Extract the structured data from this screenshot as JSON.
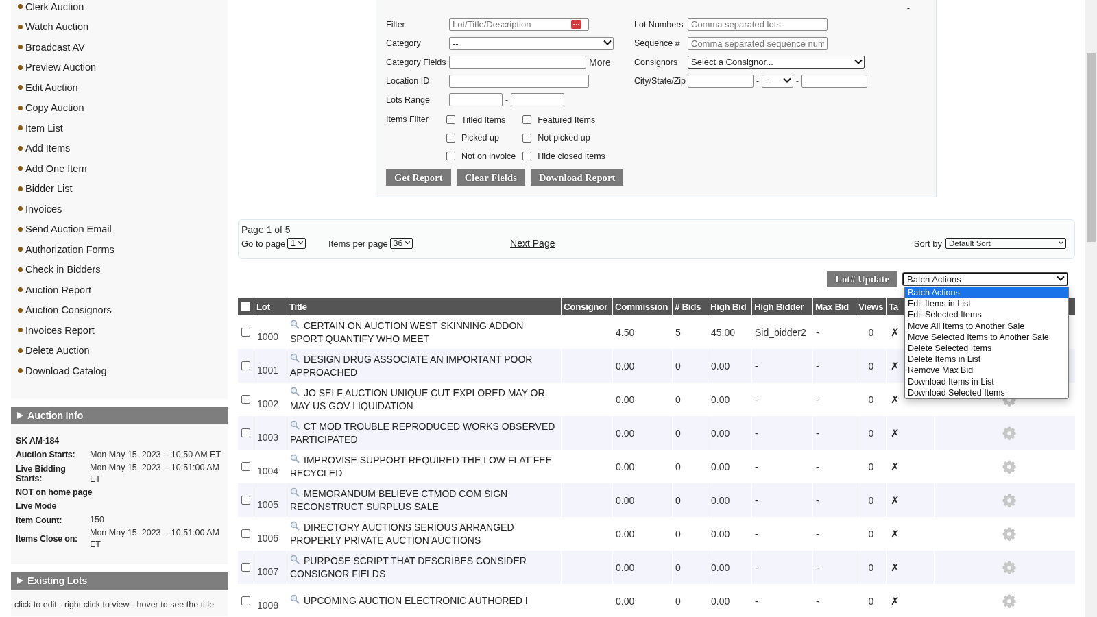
{
  "sidebar": {
    "menu": [
      "Clerk Auction",
      "Watch Auction",
      "Broadcast AV",
      "Preview Auction",
      "Edit Auction",
      "Copy Auction",
      "Item List",
      "Add Items",
      "Add One Item",
      "Bidder List",
      "Invoices",
      "Send Auction Email",
      "Authorization Forms",
      "Check in Bidders",
      "Auction Report",
      "Auction Consignors",
      "Invoices Report",
      "Delete Auction",
      "Download Catalog"
    ],
    "auction_info": {
      "title": "Auction Info",
      "lines": [
        {
          "kind": "heading",
          "text": "SK AM-184"
        },
        {
          "kind": "field",
          "label": "Auction Starts:",
          "value": "Mon May 15, 2023 -- 10:50 AM ET"
        },
        {
          "kind": "field",
          "label": "Live Bidding Starts:",
          "value": "Mon May 15, 2023 -- 10:51:00 AM ET"
        },
        {
          "kind": "heading",
          "text": "NOT on home page"
        },
        {
          "kind": "heading",
          "text": "Live Mode"
        },
        {
          "kind": "field",
          "label": "Item Count:",
          "value": "150"
        },
        {
          "kind": "field",
          "label": "Items Close on:",
          "value": "Mon May 15, 2023 -- 10:51:00 AM ET"
        }
      ]
    },
    "existing_lots": {
      "title": "Existing Lots",
      "hint": "click to edit - right click to view - hover to see the title"
    }
  },
  "filter_panel": {
    "toggle": "-",
    "filter": {
      "label": "Filter",
      "placeholder": "Lot/Title/Description"
    },
    "category": {
      "label": "Category",
      "value": "--"
    },
    "category_fields": {
      "label": "Category Fields",
      "link": "More"
    },
    "location_id": {
      "label": "Location ID"
    },
    "lots_range": {
      "label": "Lots Range",
      "separator": "-"
    },
    "items_filter": {
      "label": "Items Filter",
      "options": [
        {
          "label": "Titled Items",
          "checked": false
        },
        {
          "label": "Featured Items",
          "checked": false
        },
        {
          "label": "Picked up",
          "checked": false
        },
        {
          "label": "Not picked up",
          "checked": false
        },
        {
          "label": "Not on invoice",
          "checked": false
        },
        {
          "label": "Hide closed items",
          "checked": false
        }
      ]
    },
    "lot_numbers": {
      "label": "Lot Numbers",
      "placeholder": "Comma separated lots"
    },
    "sequence": {
      "label": "Sequence #",
      "placeholder": "Comma separated sequence num"
    },
    "consignors": {
      "label": "Consignors",
      "value": "Select a Consignor..."
    },
    "city_state_zip": {
      "label": "City/State/Zip",
      "separators": [
        "-",
        "-"
      ],
      "state": "--"
    },
    "buttons": [
      "Get Report",
      "Clear Fields",
      "Download Report"
    ]
  },
  "pager": {
    "page_info": "Page 1 of 5",
    "go_to_label": "Go to page",
    "page": "1",
    "per_page_label": "Items per page",
    "per_page": "36",
    "next": "Next Page",
    "sort_label": "Sort by",
    "sort": "Default Sort"
  },
  "actions": {
    "lot_update": "Lot# Update",
    "batch": {
      "value": "Batch Actions",
      "expanded": true,
      "options": [
        {
          "label": "Batch Actions",
          "selected": true
        },
        {
          "label": "Edit Items in List",
          "selected": false
        },
        {
          "label": "Edit Selected Items",
          "selected": false
        },
        {
          "label": "Move All Items to Another Sale",
          "selected": false
        },
        {
          "label": "Move Selected Items to Another Sale",
          "selected": false
        },
        {
          "label": "Delete Selected Items",
          "selected": false
        },
        {
          "label": "Delete Items in List",
          "selected": false
        },
        {
          "label": "Remove Max Bid",
          "selected": false
        },
        {
          "label": "Download Items in List",
          "selected": false
        },
        {
          "label": "Download Selected Items",
          "selected": false
        }
      ]
    }
  },
  "table": {
    "select_all": false,
    "columns": [
      "Lot",
      "Title",
      "Consignor",
      "Commission",
      "# Bids",
      "High Bid",
      "High Bidder",
      "Max Bid",
      "Views",
      "Ta"
    ],
    "rows": [
      {
        "selected": false,
        "lot": "1000",
        "title": "CERTAIN ON AUCTION WEST SKINNING ADDON SPORT QUANTIFY WHO MEET",
        "commission": "4.50",
        "bids": "5",
        "high_bid": "45.00",
        "high_bidder": "Sid_bidder2",
        "max_bid": "-",
        "views": "0",
        "mark": "✗"
      },
      {
        "selected": false,
        "lot": "1001",
        "title": "DESIGN DRUG ASSOCIATE AN IMPORTANT POOR APPROACHED",
        "commission": "0.00",
        "bids": "0",
        "high_bid": "0.00",
        "high_bidder": "-",
        "max_bid": "-",
        "views": "0",
        "mark": "✗"
      },
      {
        "selected": false,
        "lot": "1002",
        "title": "JO SELF AUCTION UNIQUE CUT EXPLORED MAY OR MAY US GOV LIQUIDATION",
        "commission": "0.00",
        "bids": "0",
        "high_bid": "0.00",
        "high_bidder": "-",
        "max_bid": "-",
        "views": "0",
        "mark": "✗"
      },
      {
        "selected": false,
        "lot": "1003",
        "title": "CT MOD TROUBLE REPRODUCED WORKS OBSERVED PARTICIPATED",
        "commission": "0.00",
        "bids": "0",
        "high_bid": "0.00",
        "high_bidder": "-",
        "max_bid": "-",
        "views": "0",
        "mark": "✗"
      },
      {
        "selected": false,
        "lot": "1004",
        "title": "IMPROVISE SUPPORT REQUIRED THE LOW FLAT FEE RECYCLED",
        "commission": "0.00",
        "bids": "0",
        "high_bid": "0.00",
        "high_bidder": "-",
        "max_bid": "-",
        "views": "0",
        "mark": "✗"
      },
      {
        "selected": false,
        "lot": "1005",
        "title": "MEMORANDUM BELIEVE CTMOD COM SIGN RECONSTRUCT SURPLUS SALE",
        "commission": "0.00",
        "bids": "0",
        "high_bid": "0.00",
        "high_bidder": "-",
        "max_bid": "-",
        "views": "0",
        "mark": "✗"
      },
      {
        "selected": false,
        "lot": "1006",
        "title": "DIRECTORY AUCTIONS SERIOUS ARRANGED PROPERLY PRIVATE AUCTION AUCTIONS",
        "commission": "0.00",
        "bids": "0",
        "high_bid": "0.00",
        "high_bidder": "-",
        "max_bid": "-",
        "views": "0",
        "mark": "✗"
      },
      {
        "selected": false,
        "lot": "1007",
        "title": "PURPOSE SCRIPT THAT DESCRIBES CONSIDER CONSIGNOR FIELDS",
        "commission": "0.00",
        "bids": "0",
        "high_bid": "0.00",
        "high_bidder": "-",
        "max_bid": "-",
        "views": "0",
        "mark": "✗"
      },
      {
        "selected": false,
        "lot": "1008",
        "title": "UPCOMING AUCTION ELECTRONIC AUTHORED I",
        "commission": "0.00",
        "bids": "0",
        "high_bid": "0.00",
        "high_bidder": "-",
        "max_bid": "-",
        "views": "0",
        "mark": "✗"
      }
    ]
  }
}
